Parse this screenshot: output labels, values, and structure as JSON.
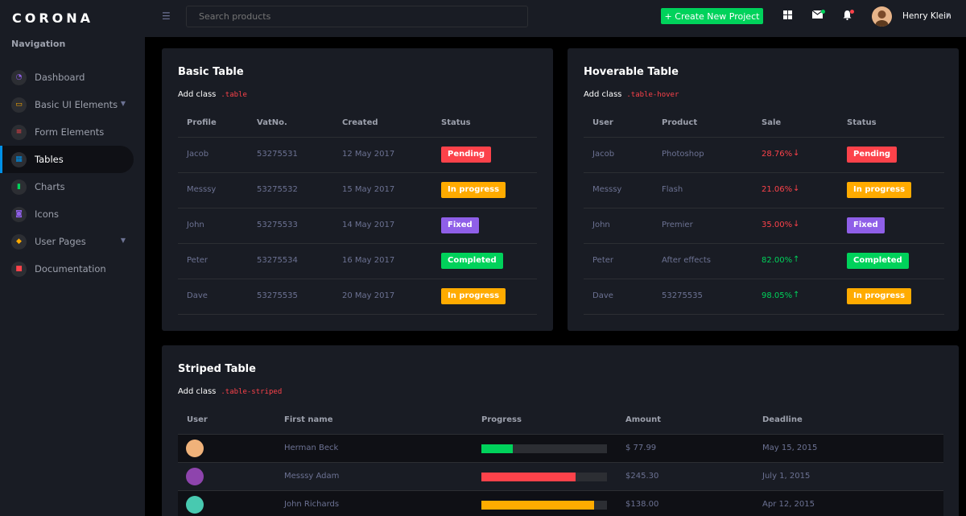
{
  "brand": "CORONA",
  "sidebar": {
    "heading": "Navigation",
    "items": [
      {
        "label": "Dashboard",
        "icon": "speedometer-icon",
        "color": "#8f5fe8",
        "glyph": "◔"
      },
      {
        "label": "Basic UI Elements",
        "icon": "laptop-icon",
        "color": "#ffab00",
        "glyph": "▭",
        "chevron": true
      },
      {
        "label": "Form Elements",
        "icon": "playlist-icon",
        "color": "#fc424a",
        "glyph": "≡"
      },
      {
        "label": "Tables",
        "icon": "table-icon",
        "color": "#0090e7",
        "glyph": "▦",
        "active": true
      },
      {
        "label": "Charts",
        "icon": "chart-bar-icon",
        "color": "#00d25b",
        "glyph": "▮"
      },
      {
        "label": "Icons",
        "icon": "contacts-icon",
        "color": "#8f5fe8",
        "glyph": "◙"
      },
      {
        "label": "User Pages",
        "icon": "security-icon",
        "color": "#ffab00",
        "glyph": "◆",
        "chevron": true
      },
      {
        "label": "Documentation",
        "icon": "file-document-icon",
        "color": "#fc424a",
        "glyph": "■"
      }
    ]
  },
  "navbar": {
    "search_placeholder": "Search products",
    "create_label": "+ Create New Project",
    "user_name": "Henry Klein"
  },
  "basic_table": {
    "title": "Basic Table",
    "desc": "Add class",
    "code": ".table",
    "headers": [
      "Profile",
      "VatNo.",
      "Created",
      "Status"
    ],
    "rows": [
      {
        "profile": "Jacob",
        "vat": "53275531",
        "created": "12 May 2017",
        "status": "Pending",
        "status_type": "danger"
      },
      {
        "profile": "Messsy",
        "vat": "53275532",
        "created": "15 May 2017",
        "status": "In progress",
        "status_type": "warning"
      },
      {
        "profile": "John",
        "vat": "53275533",
        "created": "14 May 2017",
        "status": "Fixed",
        "status_type": "primary"
      },
      {
        "profile": "Peter",
        "vat": "53275534",
        "created": "16 May 2017",
        "status": "Completed",
        "status_type": "success"
      },
      {
        "profile": "Dave",
        "vat": "53275535",
        "created": "20 May 2017",
        "status": "In progress",
        "status_type": "warning"
      }
    ]
  },
  "hover_table": {
    "title": "Hoverable Table",
    "desc": "Add class",
    "code": ".table-hover",
    "headers": [
      "User",
      "Product",
      "Sale",
      "Status"
    ],
    "rows": [
      {
        "user": "Jacob",
        "product": "Photoshop",
        "sale": "28.76%",
        "trend": "down",
        "status": "Pending",
        "status_type": "danger"
      },
      {
        "user": "Messsy",
        "product": "Flash",
        "sale": "21.06%",
        "trend": "down",
        "status": "In progress",
        "status_type": "warning"
      },
      {
        "user": "John",
        "product": "Premier",
        "sale": "35.00%",
        "trend": "down",
        "status": "Fixed",
        "status_type": "primary"
      },
      {
        "user": "Peter",
        "product": "After effects",
        "sale": "82.00%",
        "trend": "up",
        "status": "Completed",
        "status_type": "success"
      },
      {
        "user": "Dave",
        "product": "53275535",
        "sale": "98.05%",
        "trend": "up",
        "status": "In progress",
        "status_type": "warning"
      }
    ]
  },
  "striped_table": {
    "title": "Striped Table",
    "desc": "Add class",
    "code": ".table-striped",
    "headers": [
      "User",
      "First name",
      "Progress",
      "Amount",
      "Deadline"
    ],
    "rows": [
      {
        "first_name": "Herman Beck",
        "progress": 0.25,
        "color": "#00d25b",
        "amount": "$ 77.99",
        "deadline": "May 15, 2015",
        "avatar_bg": "#f0b27a"
      },
      {
        "first_name": "Messsy Adam",
        "progress": 0.75,
        "color": "#fc424a",
        "amount": "$245.30",
        "deadline": "July 1, 2015",
        "avatar_bg": "#8e44ad"
      },
      {
        "first_name": "John Richards",
        "progress": 0.9,
        "color": "#ffab00",
        "amount": "$138.00",
        "deadline": "Apr 12, 2015",
        "avatar_bg": "#48c9b0"
      }
    ]
  }
}
